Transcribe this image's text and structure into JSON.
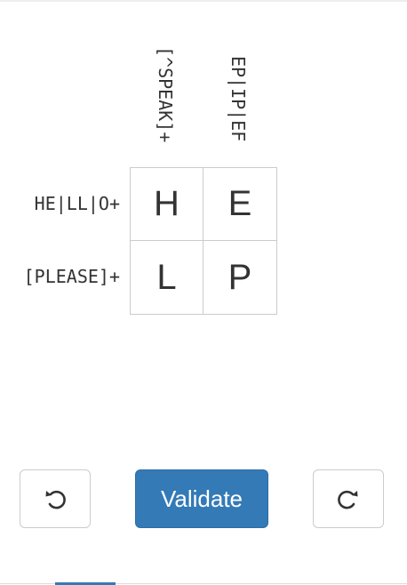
{
  "puzzle": {
    "column_clues": [
      "[^SPEAK]+",
      "EP|IP|EF"
    ],
    "row_clues": [
      "HE|LL|O+",
      "[PLEASE]+"
    ],
    "grid": [
      [
        "H",
        "E"
      ],
      [
        "L",
        "P"
      ]
    ]
  },
  "controls": {
    "undo_icon": "undo-icon",
    "validate_label": "Validate",
    "redo_icon": "redo-icon"
  },
  "colors": {
    "primary": "#337ab7",
    "border": "#cccccc",
    "text": "#333333"
  }
}
